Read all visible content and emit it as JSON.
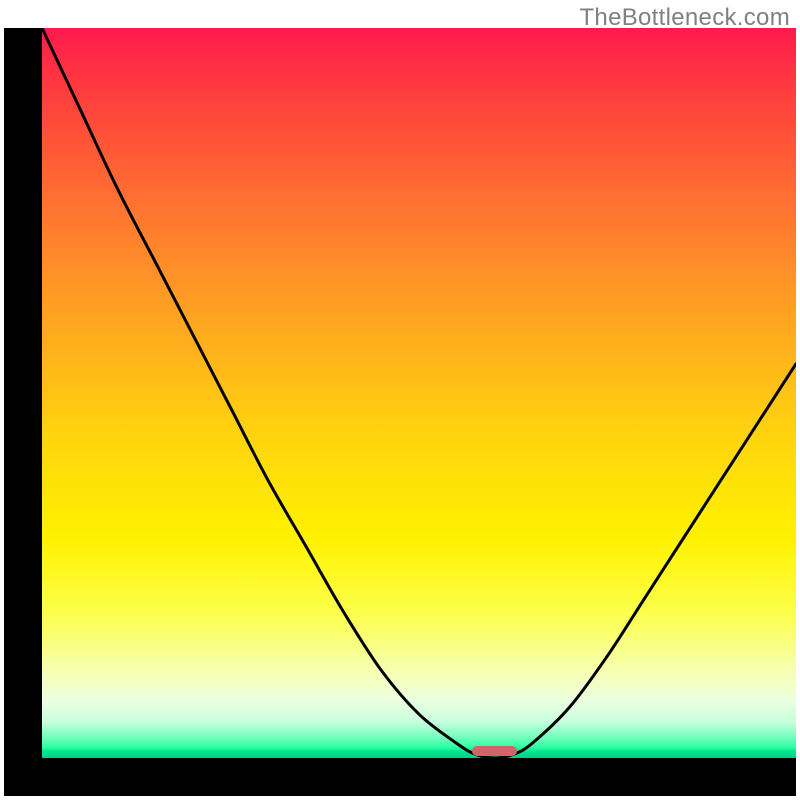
{
  "watermark": "TheBottleneck.com",
  "chart_data": {
    "type": "line",
    "title": "",
    "xlabel": "",
    "ylabel": "",
    "x": [
      0.0,
      0.05,
      0.1,
      0.15,
      0.2,
      0.25,
      0.3,
      0.35,
      0.4,
      0.45,
      0.5,
      0.55,
      0.575,
      0.6,
      0.625,
      0.65,
      0.7,
      0.75,
      0.8,
      0.85,
      0.9,
      0.95,
      1.0
    ],
    "values": [
      1.0,
      0.89,
      0.78,
      0.68,
      0.58,
      0.48,
      0.38,
      0.29,
      0.2,
      0.12,
      0.06,
      0.02,
      0.005,
      0.0,
      0.005,
      0.02,
      0.07,
      0.14,
      0.22,
      0.3,
      0.38,
      0.46,
      0.54
    ],
    "ylim": [
      0,
      1
    ],
    "xlim": [
      0,
      1
    ],
    "marker": {
      "x_center": 0.6,
      "width": 0.06
    },
    "background_gradient": [
      "#ff1a4d",
      "#ffa520",
      "#fff200",
      "#00cf87"
    ]
  }
}
